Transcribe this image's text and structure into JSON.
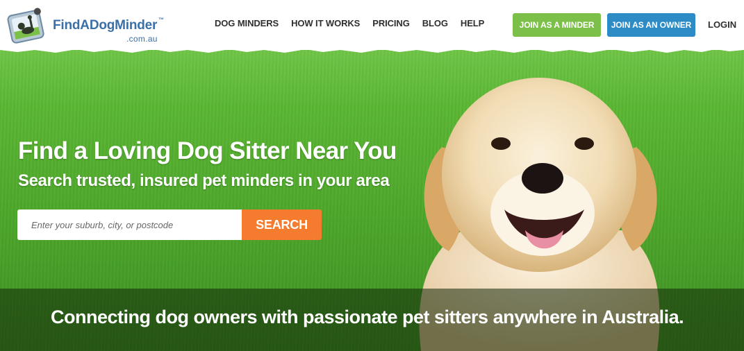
{
  "brand": {
    "name": "FindADogMinder",
    "trademark": "™",
    "domain": ".com.au",
    "color": "#3a6fa8"
  },
  "nav": {
    "items": [
      {
        "label": "DOG MINDERS"
      },
      {
        "label": "HOW IT WORKS"
      },
      {
        "label": "PRICING"
      },
      {
        "label": "BLOG"
      },
      {
        "label": "HELP"
      }
    ]
  },
  "header_actions": {
    "join_minder_label": "JOIN AS A MINDER",
    "join_owner_label": "JOIN AS AN OWNER",
    "login_label": "LOGIN",
    "minder_color": "#7cc04a",
    "owner_color": "#2d8cc5"
  },
  "hero": {
    "title": "Find a Loving Dog Sitter Near You",
    "subtitle": "Search trusted, insured pet minders in your area",
    "search": {
      "placeholder": "Enter your suburb, city, or postcode",
      "value": "",
      "button_label": "SEARCH",
      "button_color": "#f57b2e"
    },
    "tagline": "Connecting dog owners with passionate pet sitters anywhere in Australia.",
    "background_color": "#5cb834"
  }
}
